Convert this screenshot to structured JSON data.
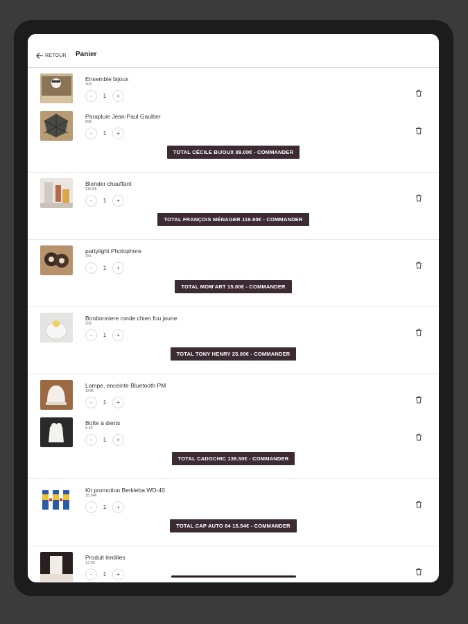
{
  "header": {
    "back_label": "RETOUR",
    "title": "Panier"
  },
  "groups": [
    {
      "items": [
        {
          "name": "Ensemble bijoux",
          "price": "20€",
          "qty": "1",
          "thumb": "jewelry-photo"
        },
        {
          "name": "Parapluie Jean-Paul Gaultier",
          "price": "69€",
          "qty": "1",
          "thumb": "umbrella-photo"
        }
      ],
      "order_label": "TOTAL CÉCILE BIJOUX 89.00€ - COMMANDER"
    },
    {
      "items": [
        {
          "name": "Blender chauffant",
          "price": "119.9€",
          "qty": "1",
          "thumb": "blender-photo"
        }
      ],
      "order_label": "TOTAL FRANÇOIS MÉNAGER 119.90€ - COMMANDER"
    },
    {
      "items": [
        {
          "name": "partylight Photophore",
          "price": "15€",
          "qty": "1",
          "thumb": "photophore-photo"
        }
      ],
      "order_label": "TOTAL MOM'ART 15.00€ - COMMANDER"
    },
    {
      "items": [
        {
          "name": "Bonbonniere ronde chien fou jaune",
          "price": "25€",
          "qty": "1",
          "thumb": "bonbonniere-photo"
        }
      ],
      "order_label": "TOTAL TONY HENRY 25.00€ - COMMANDER"
    },
    {
      "items": [
        {
          "name": "Lampe, enceinte Bluetooth PM",
          "price": "129€",
          "qty": "1",
          "thumb": "lamp-photo"
        },
        {
          "name": "Boîte à dents",
          "price": "9.5€",
          "qty": "1",
          "thumb": "tooth-box-photo"
        }
      ],
      "order_label": "TOTAL CADOCHIC 138.50€ - COMMANDER"
    },
    {
      "items": [
        {
          "name": "Kit promotion Berkleba WD-40",
          "price": "15.54€",
          "qty": "1",
          "thumb": "wd40-photo"
        }
      ],
      "order_label": "TOTAL CAP AUTO 84 15.54€ - COMMANDER"
    },
    {
      "items": [
        {
          "name": "Produit lentilles",
          "price": "13.9€",
          "qty": "1",
          "thumb": "lens-product-photo"
        }
      ]
    }
  ],
  "colors": {
    "order_button": "#3d2b33",
    "background": "#3b3b3b",
    "device": "#1c1c1c"
  }
}
